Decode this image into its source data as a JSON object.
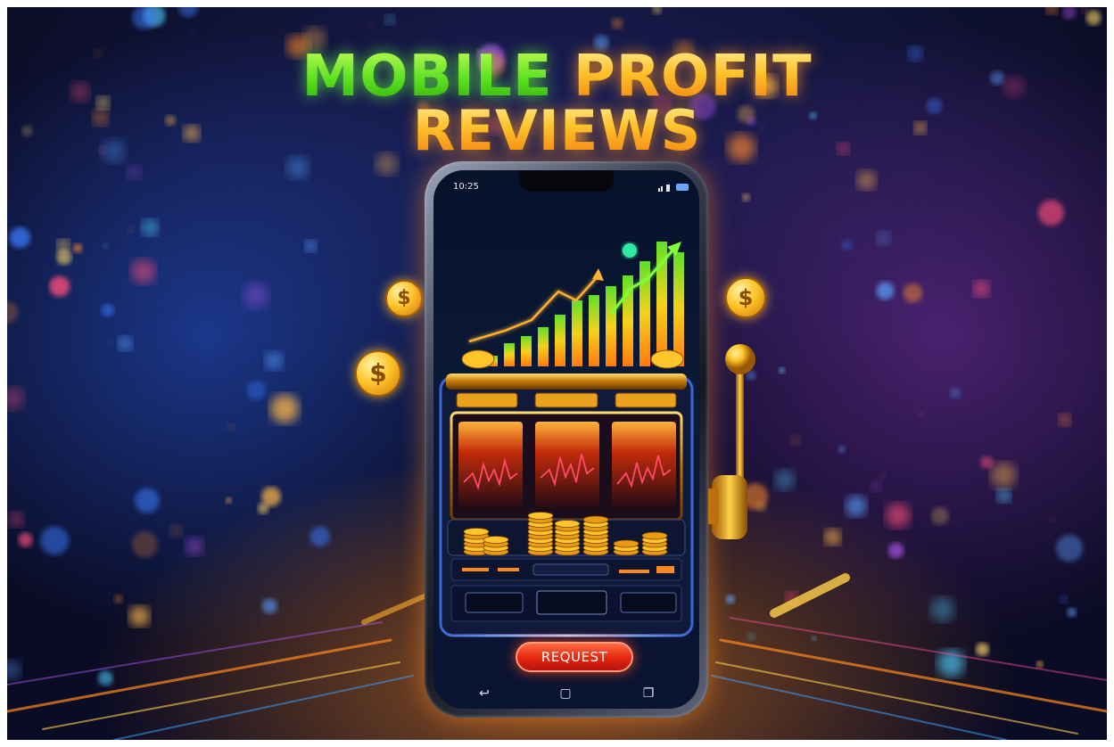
{
  "headline": {
    "line1_word1": "MOBILE",
    "line1_word2": "PROFIT",
    "line2": "REVIEWS"
  },
  "phone": {
    "status_time": "10:25",
    "cta_label": "REQUEST",
    "nav_icons": [
      "back-icon",
      "home-icon",
      "recents-icon"
    ]
  },
  "coin_symbol": "$",
  "colors": {
    "headline_green": "#59e01f",
    "headline_orange": "#ffc12a",
    "cta_red": "#e5260f",
    "gold": "#ffc52b",
    "background_navy": "#0a0b24"
  }
}
